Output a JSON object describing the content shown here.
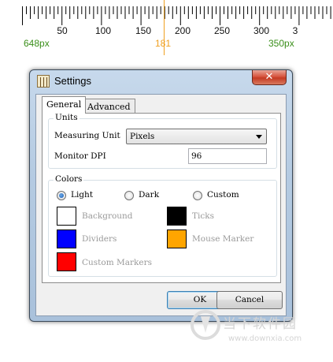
{
  "ruler": {
    "numbers": [
      "50",
      "100",
      "150",
      "200",
      "250",
      "300",
      "3"
    ],
    "marker_value": "181",
    "left_px": "648px",
    "right_px": "350px",
    "marker_color": "#f0a020",
    "px_color": "#3a8f1a"
  },
  "window": {
    "title": "Settings",
    "close_label": "✕"
  },
  "tabs": [
    {
      "label": "General",
      "active": true
    },
    {
      "label": "Advanced",
      "active": false
    }
  ],
  "units": {
    "group_label": "Units",
    "measuring_unit_label": "Measuring Unit",
    "measuring_unit_value": "Pixels",
    "monitor_dpi_label": "Monitor DPI",
    "monitor_dpi_value": "96"
  },
  "colors": {
    "group_label": "Colors",
    "themes": [
      {
        "label": "Light",
        "checked": true
      },
      {
        "label": "Dark",
        "checked": false
      },
      {
        "label": "Custom",
        "checked": false
      }
    ],
    "items": [
      {
        "label": "Background",
        "color": "#ffffff"
      },
      {
        "label": "Ticks",
        "color": "#000000"
      },
      {
        "label": "Dividers",
        "color": "#0000ff"
      },
      {
        "label": "Mouse Marker",
        "color": "#ffa500"
      },
      {
        "label": "Custom Markers",
        "color": "#ff0000"
      }
    ]
  },
  "buttons": {
    "ok": "OK",
    "cancel": "Cancel"
  },
  "watermark": {
    "text": "当下软件园",
    "url": "www.downxia.com"
  }
}
